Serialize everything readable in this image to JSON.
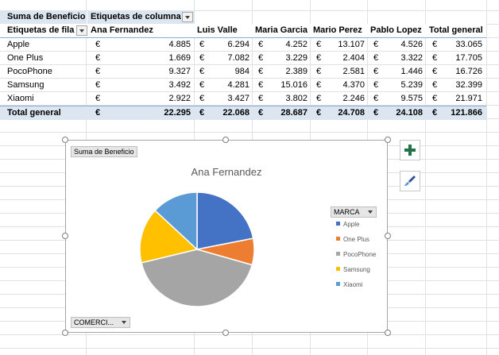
{
  "pivot": {
    "value_field": "Suma de Beneficio",
    "column_labels": "Etiquetas de columna",
    "row_labels": "Etiquetas de fila",
    "columns": [
      "Ana Fernandez",
      "Luis Valle",
      "Maria Garcia",
      "Mario Perez",
      "Pablo Lopez",
      "Total general"
    ],
    "currency": "€",
    "rows": [
      {
        "label": "Apple",
        "values": [
          "4.885",
          "6.294",
          "4.252",
          "13.107",
          "4.526",
          "33.065"
        ]
      },
      {
        "label": "One Plus",
        "values": [
          "1.669",
          "7.082",
          "3.229",
          "2.404",
          "3.322",
          "17.705"
        ]
      },
      {
        "label": "PocoPhone",
        "values": [
          "9.327",
          "984",
          "2.389",
          "2.581",
          "1.446",
          "16.726"
        ]
      },
      {
        "label": "Samsung",
        "values": [
          "3.492",
          "4.281",
          "15.016",
          "4.370",
          "5.239",
          "32.399"
        ]
      },
      {
        "label": "Xiaomi",
        "values": [
          "2.922",
          "3.427",
          "3.802",
          "2.246",
          "9.575",
          "21.971"
        ]
      }
    ],
    "total": {
      "label": "Total general",
      "values": [
        "22.295",
        "22.068",
        "28.687",
        "24.708",
        "24.108",
        "121.866"
      ]
    }
  },
  "chart": {
    "value_field_button": "Suma de Beneficio",
    "legend_field_button": "MARCA",
    "axis_field_button": "COMERCI...",
    "colors": [
      "#4472c4",
      "#ed7d31",
      "#a5a5a5",
      "#ffc000",
      "#5b9bd5"
    ]
  },
  "chart_data": {
    "type": "pie",
    "title": "Ana Fernandez",
    "categories": [
      "Apple",
      "One Plus",
      "PocoPhone",
      "Samsung",
      "Xiaomi"
    ],
    "values": [
      4885,
      1669,
      9327,
      3492,
      2922
    ],
    "legend_position": "right"
  },
  "side_buttons": {
    "add_icon": "plus-icon",
    "style_icon": "brush-icon"
  }
}
